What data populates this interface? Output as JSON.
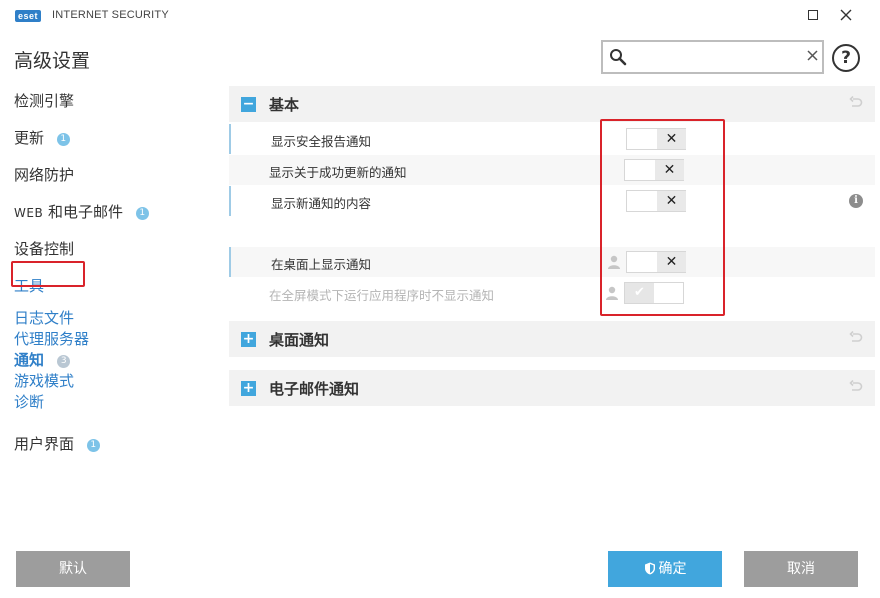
{
  "window": {
    "logo_text": "eset",
    "product_name": "INTERNET SECURITY"
  },
  "header": {
    "title": "高级设置",
    "search": {
      "value": "",
      "placeholder": ""
    }
  },
  "sidebar": {
    "items": [
      {
        "label": "检测引擎"
      },
      {
        "label": "更新",
        "badge": "1"
      },
      {
        "label": "网络防护"
      },
      {
        "prefix": "WEB",
        "label": " 和电子邮件",
        "badge": "1"
      },
      {
        "label": "设备控制"
      },
      {
        "label": "工具"
      },
      {
        "label": "日志文件"
      },
      {
        "label": "代理服务器"
      },
      {
        "label": "通知",
        "badge": "3"
      },
      {
        "label": "游戏模式"
      },
      {
        "label": "诊断"
      },
      {
        "label": "用户界面",
        "badge": "1"
      }
    ]
  },
  "sections": {
    "basic": {
      "title": "基本",
      "rows": [
        {
          "label": "显示安全报告通知",
          "state": "off"
        },
        {
          "label": "显示关于成功更新的通知",
          "state": "off"
        },
        {
          "label": "显示新通知的内容",
          "state": "off"
        },
        {
          "label": "在桌面上显示通知",
          "state": "off"
        },
        {
          "label": "在全屏模式下运行应用程序时不显示通知",
          "state": "on"
        }
      ]
    },
    "desktop": {
      "title": "桌面通知"
    },
    "email": {
      "title": "电子邮件通知"
    }
  },
  "footer": {
    "default_label": "默认",
    "ok_label": "确定",
    "cancel_label": "取消"
  },
  "colors": {
    "accent": "#41a6dd",
    "link": "#2f7fc8",
    "highlight": "#d9232a",
    "button_gray": "#9d9d9d"
  }
}
